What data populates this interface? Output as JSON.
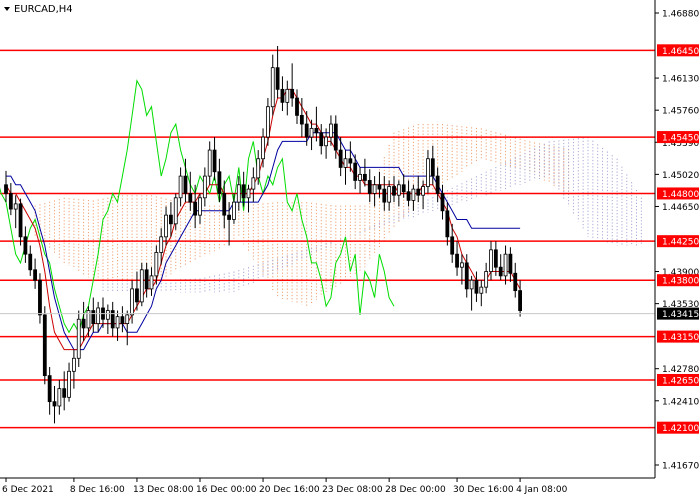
{
  "header": {
    "symbol_label": "EURCAD,H4"
  },
  "chart_data": {
    "type": "candlestick",
    "symbol": "EURCAD",
    "timeframe": "H4",
    "ylim": [
      1.4152,
      1.4703
    ],
    "y_tick_labels": [
      "1.46880",
      "1.46130",
      "1.45760",
      "1.45390",
      "1.45020",
      "1.44650",
      "1.43900",
      "1.43530",
      "1.42780",
      "1.42410",
      "1.41670"
    ],
    "x_tick_labels": [
      "6 Dec 2021",
      "8 Dec 16:00",
      "13 Dec 08:00",
      "16 Dec 00:00",
      "20 Dec 16:00",
      "23 Dec 08:00",
      "28 Dec 00:00",
      "30 Dec 16:00",
      "4 Jan 08:00"
    ],
    "grid": false,
    "current_price": "1.43415",
    "current_price_value": 1.43415,
    "levels": [
      {
        "label": "1.46450",
        "value": 1.4645
      },
      {
        "label": "1.45450",
        "value": 1.4545
      },
      {
        "label": "1.44800",
        "value": 1.448
      },
      {
        "label": "1.44250",
        "value": 1.4425
      },
      {
        "label": "1.43800",
        "value": 1.438
      },
      {
        "label": "1.43150",
        "value": 1.4315
      },
      {
        "label": "1.42650",
        "value": 1.4265
      },
      {
        "label": "1.42100",
        "value": 1.421
      }
    ],
    "candles_ohlc": [
      [
        1.449,
        1.4506,
        1.447,
        1.448
      ],
      [
        1.448,
        1.4492,
        1.4455,
        1.4462
      ],
      [
        1.4462,
        1.4478,
        1.444,
        1.4468
      ],
      [
        1.4468,
        1.4474,
        1.442,
        1.443
      ],
      [
        1.443,
        1.4442,
        1.44,
        1.441
      ],
      [
        1.441,
        1.442,
        1.4385,
        1.4392
      ],
      [
        1.4392,
        1.4405,
        1.437,
        1.438
      ],
      [
        1.438,
        1.4388,
        1.433,
        1.434
      ],
      [
        1.434,
        1.435,
        1.426,
        1.427
      ],
      [
        1.427,
        1.428,
        1.4225,
        1.424
      ],
      [
        1.424,
        1.4258,
        1.4215,
        1.4235
      ],
      [
        1.4235,
        1.4265,
        1.4225,
        1.4255
      ],
      [
        1.4255,
        1.4275,
        1.423,
        1.4245
      ],
      [
        1.4245,
        1.4285,
        1.424,
        1.4275
      ],
      [
        1.4275,
        1.43,
        1.4255,
        1.429
      ],
      [
        1.429,
        1.4345,
        1.428,
        1.4335
      ],
      [
        1.4335,
        1.4355,
        1.431,
        1.4325
      ],
      [
        1.4325,
        1.435,
        1.4315,
        1.4345
      ],
      [
        1.4345,
        1.436,
        1.432,
        1.433
      ],
      [
        1.433,
        1.4355,
        1.432,
        1.4348
      ],
      [
        1.4348,
        1.436,
        1.4325,
        1.4335
      ],
      [
        1.4335,
        1.4352,
        1.4318,
        1.4345
      ],
      [
        1.4345,
        1.4355,
        1.4315,
        1.4325
      ],
      [
        1.4325,
        1.4345,
        1.431,
        1.4338
      ],
      [
        1.4338,
        1.435,
        1.432,
        1.433
      ],
      [
        1.433,
        1.4345,
        1.4305,
        1.434
      ],
      [
        1.434,
        1.438,
        1.433,
        1.437
      ],
      [
        1.437,
        1.439,
        1.4345,
        1.4355
      ],
      [
        1.4355,
        1.44,
        1.435,
        1.4392
      ],
      [
        1.4392,
        1.44,
        1.436,
        1.437
      ],
      [
        1.437,
        1.4395,
        1.4362,
        1.4385
      ],
      [
        1.4385,
        1.442,
        1.4375,
        1.4412
      ],
      [
        1.4412,
        1.444,
        1.4398,
        1.443
      ],
      [
        1.443,
        1.4465,
        1.442,
        1.4455
      ],
      [
        1.4455,
        1.447,
        1.443,
        1.4445
      ],
      [
        1.4445,
        1.448,
        1.4438,
        1.4475
      ],
      [
        1.4475,
        1.451,
        1.4465,
        1.45
      ],
      [
        1.45,
        1.452,
        1.447,
        1.448
      ],
      [
        1.448,
        1.4505,
        1.446,
        1.447
      ],
      [
        1.447,
        1.449,
        1.444,
        1.4455
      ],
      [
        1.4455,
        1.448,
        1.4445,
        1.4475
      ],
      [
        1.4475,
        1.451,
        1.4465,
        1.45
      ],
      [
        1.45,
        1.454,
        1.449,
        1.453
      ],
      [
        1.453,
        1.4545,
        1.4495,
        1.4505
      ],
      [
        1.4505,
        1.452,
        1.447,
        1.448
      ],
      [
        1.448,
        1.4495,
        1.444,
        1.4455
      ],
      [
        1.4455,
        1.447,
        1.442,
        1.445
      ],
      [
        1.445,
        1.448,
        1.4445,
        1.447
      ],
      [
        1.447,
        1.45,
        1.446,
        1.449
      ],
      [
        1.449,
        1.4505,
        1.4465,
        1.4475
      ],
      [
        1.4475,
        1.449,
        1.4458,
        1.4485
      ],
      [
        1.4485,
        1.451,
        1.447,
        1.4498
      ],
      [
        1.4498,
        1.453,
        1.449,
        1.452
      ],
      [
        1.452,
        1.4555,
        1.451,
        1.4545
      ],
      [
        1.4545,
        1.459,
        1.4535,
        1.458
      ],
      [
        1.458,
        1.464,
        1.457,
        1.4625
      ],
      [
        1.4625,
        1.465,
        1.459,
        1.46
      ],
      [
        1.46,
        1.4615,
        1.4575,
        1.4585
      ],
      [
        1.4585,
        1.461,
        1.457,
        1.46
      ],
      [
        1.46,
        1.463,
        1.458,
        1.459
      ],
      [
        1.459,
        1.46,
        1.456,
        1.457
      ],
      [
        1.457,
        1.459,
        1.4545,
        1.456
      ],
      [
        1.456,
        1.4575,
        1.4535,
        1.4545
      ],
      [
        1.4545,
        1.4565,
        1.453,
        1.4555
      ],
      [
        1.4555,
        1.458,
        1.454,
        1.455
      ],
      [
        1.455,
        1.456,
        1.4525,
        1.4535
      ],
      [
        1.4535,
        1.4555,
        1.452,
        1.4545
      ],
      [
        1.4545,
        1.457,
        1.4535,
        1.456
      ],
      [
        1.456,
        1.457,
        1.452,
        1.453
      ],
      [
        1.453,
        1.4545,
        1.45,
        1.451
      ],
      [
        1.451,
        1.453,
        1.449,
        1.452
      ],
      [
        1.452,
        1.454,
        1.4505,
        1.4515
      ],
      [
        1.4515,
        1.4525,
        1.4485,
        1.4495
      ],
      [
        1.4495,
        1.451,
        1.448,
        1.4502
      ],
      [
        1.4502,
        1.452,
        1.4488,
        1.4495
      ],
      [
        1.4495,
        1.4508,
        1.447,
        1.448
      ],
      [
        1.448,
        1.45,
        1.4465,
        1.449
      ],
      [
        1.449,
        1.4505,
        1.4475,
        1.4485
      ],
      [
        1.4485,
        1.45,
        1.446,
        1.447
      ],
      [
        1.447,
        1.4495,
        1.446,
        1.4488
      ],
      [
        1.4488,
        1.45,
        1.447,
        1.4478
      ],
      [
        1.4478,
        1.4495,
        1.4465,
        1.449
      ],
      [
        1.449,
        1.4502,
        1.4475,
        1.4482
      ],
      [
        1.4482,
        1.4495,
        1.4465,
        1.4472
      ],
      [
        1.4472,
        1.449,
        1.446,
        1.4485
      ],
      [
        1.4485,
        1.45,
        1.447,
        1.4478
      ],
      [
        1.4478,
        1.4495,
        1.4462,
        1.4488
      ],
      [
        1.4488,
        1.453,
        1.448,
        1.452
      ],
      [
        1.452,
        1.4535,
        1.449,
        1.45
      ],
      [
        1.45,
        1.451,
        1.447,
        1.448
      ],
      [
        1.448,
        1.449,
        1.445,
        1.446
      ],
      [
        1.446,
        1.447,
        1.442,
        1.443
      ],
      [
        1.443,
        1.4445,
        1.44,
        1.441
      ],
      [
        1.441,
        1.4425,
        1.4385,
        1.4395
      ],
      [
        1.4395,
        1.441,
        1.4375,
        1.44
      ],
      [
        1.44,
        1.441,
        1.436,
        1.437
      ],
      [
        1.437,
        1.4385,
        1.4345,
        1.438
      ],
      [
        1.438,
        1.439,
        1.4355,
        1.4365
      ],
      [
        1.4365,
        1.438,
        1.435,
        1.4372
      ],
      [
        1.4372,
        1.44,
        1.4365,
        1.439
      ],
      [
        1.439,
        1.4425,
        1.438,
        1.4415
      ],
      [
        1.4415,
        1.4425,
        1.4385,
        1.4395
      ],
      [
        1.4395,
        1.441,
        1.438,
        1.4385
      ],
      [
        1.4385,
        1.442,
        1.4375,
        1.441
      ],
      [
        1.441,
        1.4418,
        1.4378,
        1.4388
      ],
      [
        1.4388,
        1.44,
        1.436,
        1.4368
      ],
      [
        1.4368,
        1.438,
        1.4338,
        1.4345
      ]
    ],
    "indicators": {
      "tenkan_sen": [
        1.449,
        1.448,
        1.448,
        1.447,
        1.446,
        1.445,
        1.444,
        1.442,
        1.439,
        1.435,
        1.432,
        1.431,
        1.43,
        1.43,
        1.43,
        1.43,
        1.431,
        1.432,
        1.433,
        1.433,
        1.433,
        1.433,
        1.433,
        1.433,
        1.433,
        1.433,
        1.434,
        1.435,
        1.436,
        1.437,
        1.437,
        1.438,
        1.44,
        1.442,
        1.443,
        1.445,
        1.446,
        1.447,
        1.447,
        1.447,
        1.448,
        1.448,
        1.449,
        1.449,
        1.449,
        1.448,
        1.448,
        1.448,
        1.448,
        1.448,
        1.448,
        1.449,
        1.45,
        1.452,
        1.454,
        1.457,
        1.459,
        1.459,
        1.46,
        1.46,
        1.459,
        1.458,
        1.457,
        1.456,
        1.456,
        1.455,
        1.454,
        1.454,
        1.453,
        1.452,
        1.451,
        1.451,
        1.45,
        1.45,
        1.449,
        1.449,
        1.449,
        1.449,
        1.449,
        1.449,
        1.449,
        1.448,
        1.448,
        1.448,
        1.448,
        1.448,
        1.449,
        1.449,
        1.449,
        1.448,
        1.447,
        1.446,
        1.444,
        1.443,
        1.441,
        1.44,
        1.439,
        1.438,
        1.438,
        1.438,
        1.439,
        1.439,
        1.439,
        1.439,
        1.439,
        1.438,
        1.437
      ],
      "kijun_sen": [
        1.45,
        1.45,
        1.449,
        1.449,
        1.448,
        1.447,
        1.446,
        1.444,
        1.442,
        1.439,
        1.436,
        1.434,
        1.432,
        1.431,
        1.43,
        1.43,
        1.43,
        1.431,
        1.432,
        1.432,
        1.433,
        1.433,
        1.433,
        1.433,
        1.433,
        1.432,
        1.432,
        1.432,
        1.433,
        1.434,
        1.435,
        1.437,
        1.438,
        1.44,
        1.441,
        1.442,
        1.443,
        1.444,
        1.445,
        1.446,
        1.446,
        1.446,
        1.446,
        1.446,
        1.446,
        1.446,
        1.446,
        1.447,
        1.447,
        1.447,
        1.447,
        1.447,
        1.447,
        1.448,
        1.449,
        1.451,
        1.453,
        1.454,
        1.454,
        1.454,
        1.454,
        1.454,
        1.454,
        1.455,
        1.455,
        1.455,
        1.455,
        1.455,
        1.455,
        1.454,
        1.453,
        1.453,
        1.452,
        1.451,
        1.451,
        1.451,
        1.451,
        1.451,
        1.451,
        1.451,
        1.451,
        1.451,
        1.45,
        1.45,
        1.45,
        1.45,
        1.45,
        1.45,
        1.45,
        1.449,
        1.448,
        1.447,
        1.446,
        1.445,
        1.445,
        1.445,
        1.444,
        1.444,
        1.444,
        1.444,
        1.444,
        1.444,
        1.444,
        1.444,
        1.444,
        1.444,
        1.444
      ],
      "chikou_span": [
        1.45,
        1.448,
        1.447,
        1.444,
        1.441,
        1.44,
        1.442,
        1.444,
        1.445,
        1.443,
        1.441,
        1.44,
        1.437,
        1.435,
        1.433,
        1.432,
        1.433,
        1.432,
        1.434,
        1.435,
        1.438,
        1.441,
        1.445,
        1.446,
        1.448,
        1.447,
        1.45,
        1.453,
        1.457,
        1.461,
        1.46,
        1.457,
        1.458,
        1.454,
        1.45,
        1.452,
        1.455,
        1.456,
        1.453,
        1.451,
        1.449,
        1.448,
        1.45,
        1.449,
        1.448,
        1.45,
        1.447,
        1.449,
        1.45,
        1.447,
        1.451,
        1.446,
        1.452,
        1.454,
        1.45,
        1.448,
        1.45,
        1.449,
        1.451,
        1.452,
        1.447,
        1.446,
        1.448,
        1.445,
        1.443,
        1.44,
        1.44,
        1.438,
        1.435,
        1.436,
        1.44,
        1.441,
        1.443,
        1.439,
        1.441,
        1.434,
        1.439,
        1.438,
        1.436,
        1.441,
        1.439,
        1.436,
        1.435
      ],
      "cloud_orange": [
        [
          6,
          1.4466,
          1.443
        ],
        [
          12,
          1.4475,
          1.44
        ],
        [
          18,
          1.4472,
          1.438
        ],
        [
          24,
          1.4478,
          1.438
        ],
        [
          30,
          1.4478,
          1.437
        ],
        [
          36,
          1.447,
          1.4395
        ],
        [
          42,
          1.4466,
          1.441
        ],
        [
          48,
          1.4466,
          1.443
        ],
        [
          56,
          1.447,
          1.436
        ],
        [
          62,
          1.447,
          1.435
        ],
        [
          68,
          1.4466,
          1.4372
        ],
        [
          74,
          1.4466,
          1.4395
        ],
        [
          80,
          1.455,
          1.444
        ],
        [
          85,
          1.456,
          1.447
        ],
        [
          90,
          1.456,
          1.449
        ],
        [
          98,
          1.4555,
          1.452
        ],
        [
          108,
          1.454,
          1.4505
        ],
        [
          117,
          1.453,
          1.4475
        ]
      ],
      "cloud_blue": [
        [
          20,
          1.4366,
          1.438
        ],
        [
          30,
          1.4366,
          1.438
        ],
        [
          40,
          1.4366,
          1.4382
        ],
        [
          47,
          1.4366,
          1.439
        ],
        [
          112,
          1.454,
          1.45
        ],
        [
          120,
          1.4545,
          1.443
        ],
        [
          126,
          1.452,
          1.442
        ],
        [
          132,
          1.4466,
          1.442
        ]
      ]
    }
  }
}
